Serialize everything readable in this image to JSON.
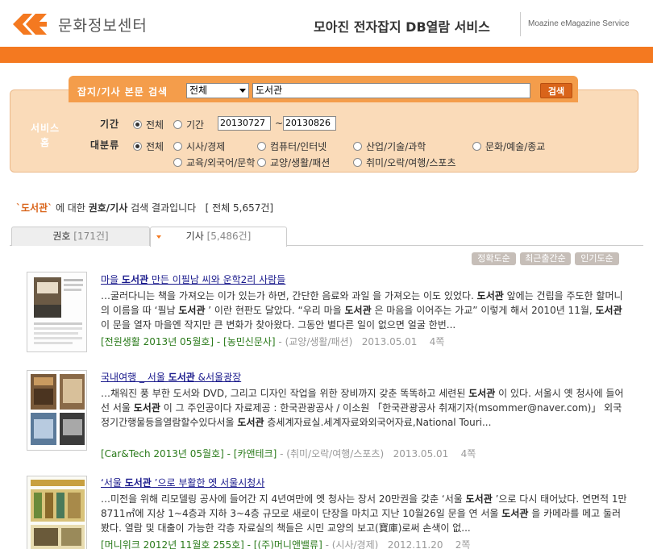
{
  "header": {
    "logo_text": "문화정보센터",
    "service_title": "모아진 전자잡지 DB열람 서비스",
    "service_en": "Moazine eMagazine Service",
    "brand_color": "#f47920"
  },
  "search": {
    "tab_label": "잡지/기사 본문 검색",
    "scope_selected": "전체",
    "query": "도서관",
    "button_label": "검색"
  },
  "panel": {
    "side_label": "서비스 홈",
    "period_label": "기간",
    "period_all": "전체",
    "period_range": "기간",
    "date_from": "20130727",
    "date_to": "20130826",
    "tilde": "~",
    "category_label": "대분류",
    "categories": [
      "전체",
      "시사/경제",
      "컴퓨터/인터넷",
      "산업/기술/과학",
      "문화/예술/종교",
      "교육/외국어/문학",
      "교양/생활/패션",
      "취미/오락/여행/스포츠"
    ]
  },
  "results": {
    "keyword": "`도서관`",
    "summary_mid": " 에 대한 ",
    "summary_target": "권호/기사",
    "summary_end": " 검색 결과입니다",
    "total": "[ 전체 5,657건]"
  },
  "tabs": [
    {
      "label": "권호",
      "count": "[171건]"
    },
    {
      "label": "기사",
      "count": "[5,486건]"
    }
  ],
  "sort_buttons": [
    "정확도순",
    "최근출간순",
    "인기도순"
  ],
  "items": [
    {
      "title_pre": "마을 ",
      "title_kw": "도서관",
      "title_post": " 만든 이필남 씨와 운학2리 사람들",
      "snippet": "…굴러다니는 책을 가져오는 이가 있는가 하면, 간단한 음료와 과일 을 가져오는 이도 있었다. 도서관 앞에는 건립을 주도한 할머니의 이름을 따 ‘필남 도서관 ’ 이란 현판도 달았다. “우리 마을 도서관 은 마음을 이어주는 가교” 이렇게 해서 2010년 11월, 도서관 이 문을 열자 마을엔 작지만 큰 변화가 찾아왔다. 그동안 별다른 일이 없으면 얼굴 한번...",
      "source": "[전원생활 2013년 05월호] - [농민신문사]",
      "category": " - (교양/생활/패션)",
      "date": "2013.05.01",
      "pages": "4쪽"
    },
    {
      "title_pre": "국내여행 _ 서울 ",
      "title_kw": "도서관",
      "title_post": " &서울광장",
      "snippet": "…채워진 풍 부한 도서와 DVD, 그리고 디자인 작업을 위한 장비까지 갖춘 똑똑하고 세련된 도서관 이 있다. 서울시 옛 청사에 들어선 서울 도서관 이 그 주인공이다 자료제공 : 한국관광공사 / 이소원 「한국관광공사 취재기자(msommer@naver.com)」 외국정기간행물등을열람할수있다서울 도서관 층세계자료실.세계자료와외국어자료,National Touri...",
      "source": "[Car&Tech 2013년 05월호] - [카앤테크]",
      "category": " - (취미/오락/여행/스포츠)",
      "date": "2013.05.01",
      "pages": "4쪽"
    },
    {
      "title_pre": "‘서울 ",
      "title_kw": "도서관",
      "title_post": " ’으로 부활한 옛 서울시청사",
      "snippet": "…미전을 위해 리모델링 공사에 들어간 지 4년여만에 옛 청사는 장서 20만권을 갖춘 ‘서울 도서관 ’으로 다시 태어났다. 연면적 1만8711㎡에 지상 1~4층과 지하 3~4층 규모로 새로이 단장을 마치고 지난 10월26일 문을 연 서울 도서관 을 카메라를 메고 둘러봤다. 열람 및 대출이 가능한 각층 자료실의 책들은 시민 교양의 보고(寶庫)로써 손색이 없...",
      "source": "[머니위크 2012년 11월호 255호] - [(주)머니앤밸류]",
      "category": " - (시사/경제)",
      "date": "2012.11.20",
      "pages": "2쪽"
    }
  ]
}
